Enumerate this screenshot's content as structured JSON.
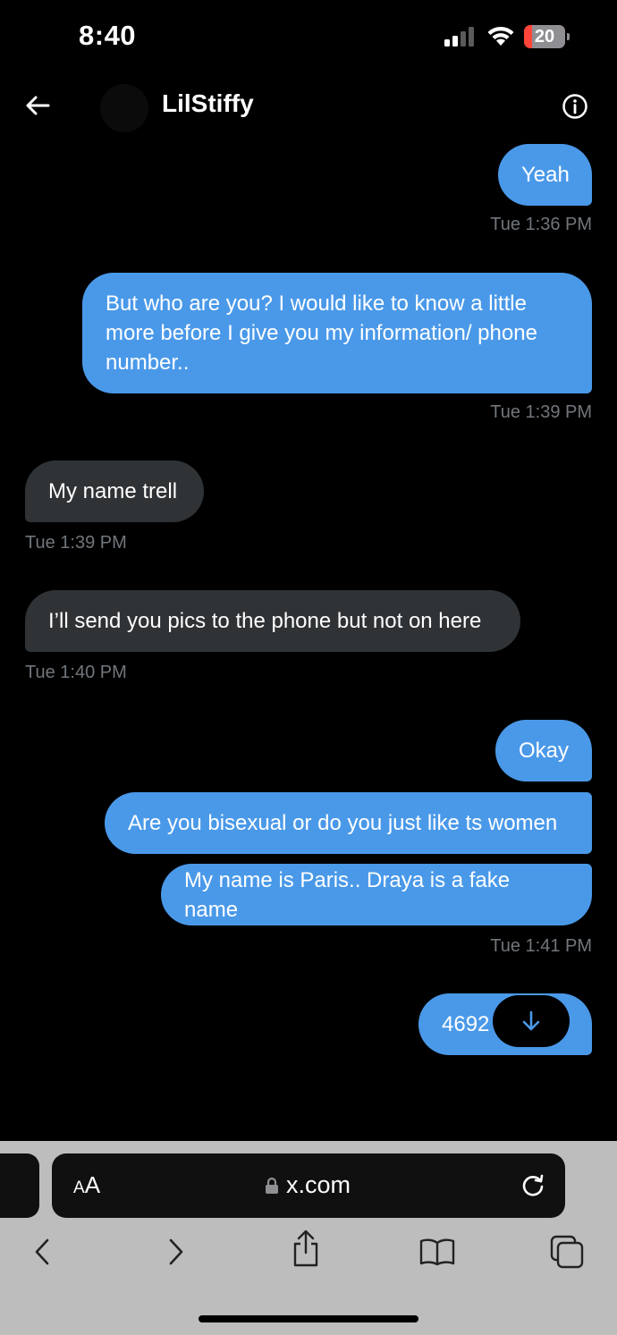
{
  "status_bar": {
    "time": "8:40",
    "battery_level": "20"
  },
  "header": {
    "contact_name": "LilStiffy",
    "back_icon": "arrow-left-icon",
    "info_icon": "info-circle-icon"
  },
  "messages": [
    {
      "text": "Yeah",
      "direction": "outgoing"
    },
    {
      "timestamp": "Tue 1:36 PM"
    },
    {
      "text": "But who are you? I would like to know a little more before I give you my information/ phone number..",
      "direction": "outgoing"
    },
    {
      "timestamp": "Tue 1:39 PM"
    },
    {
      "text": "My name trell",
      "direction": "incoming"
    },
    {
      "timestamp": "Tue 1:39 PM"
    },
    {
      "text": "I’ll send you pics to the phone but not on here",
      "direction": "incoming"
    },
    {
      "timestamp": "Tue 1:40 PM"
    },
    {
      "text": "Okay",
      "direction": "outgoing"
    },
    {
      "text": "Are you bisexual or do you just like ts women",
      "direction": "outgoing"
    },
    {
      "text": "My name is Paris.. Draya is a fake name",
      "direction": "outgoing"
    },
    {
      "timestamp": "Tue 1:41 PM"
    },
    {
      "text": "4692",
      "direction": "outgoing"
    }
  ],
  "safari": {
    "aa_label_small": "A",
    "aa_label_large": "A",
    "url": "x.com"
  },
  "colors": {
    "outgoing_bubble": "#4a99e9",
    "incoming_bubble": "#2f3336",
    "timestamp": "#71767b"
  }
}
